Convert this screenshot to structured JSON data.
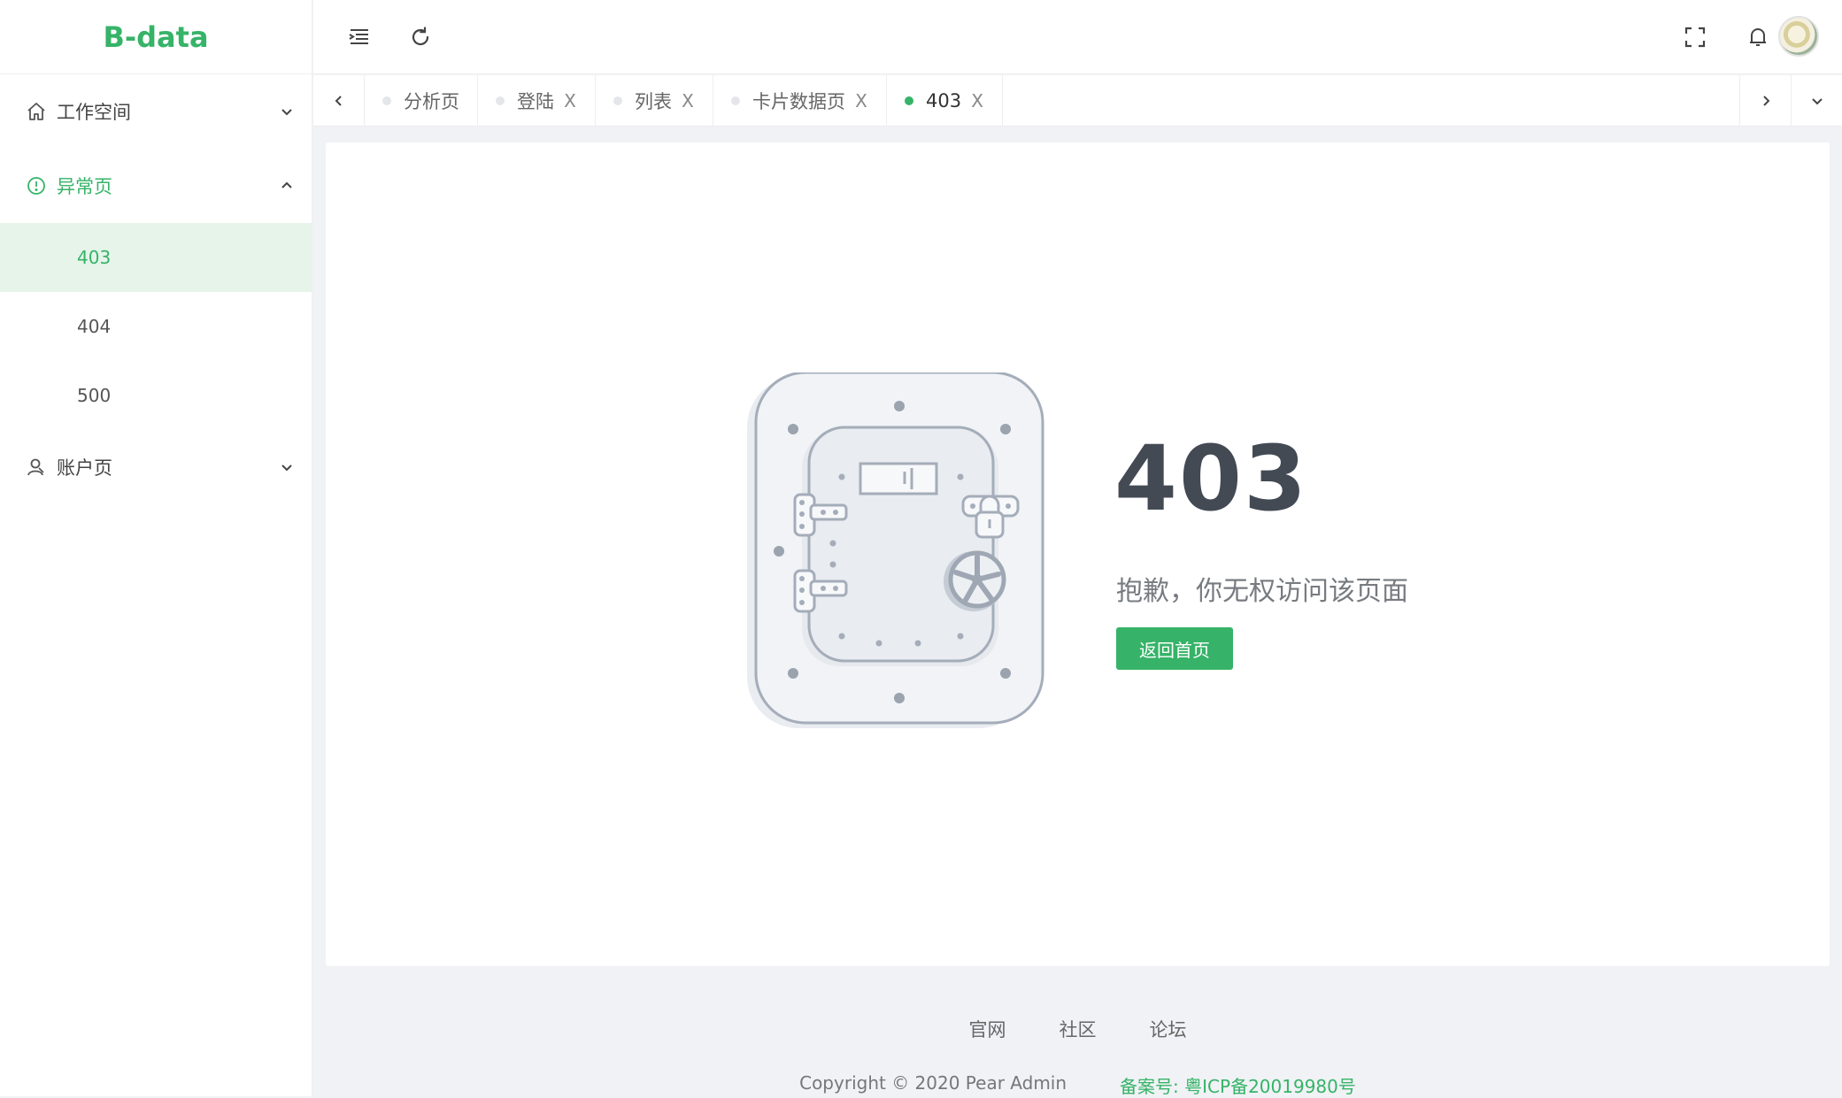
{
  "app": {
    "logo": "B-data",
    "brand_color": "#36b368"
  },
  "sidebar": {
    "groups": [
      {
        "label": "工作空间",
        "icon": "home-icon",
        "expanded": false
      },
      {
        "label": "异常页",
        "icon": "alert-circle-icon",
        "expanded": true,
        "items": [
          {
            "label": "403",
            "active": true
          },
          {
            "label": "404"
          },
          {
            "label": "500"
          }
        ]
      },
      {
        "label": "账户页",
        "icon": "user-icon",
        "expanded": false
      }
    ]
  },
  "header": {
    "icons": [
      "menu-fold-icon",
      "refresh-icon",
      "fullscreen-icon",
      "bell-icon",
      "avatar"
    ]
  },
  "tabs": [
    {
      "label": "分析页",
      "closable": false,
      "active": false
    },
    {
      "label": "登陆",
      "closable": true,
      "active": false
    },
    {
      "label": "列表",
      "closable": true,
      "active": false
    },
    {
      "label": "卡片数据页",
      "closable": true,
      "active": false
    },
    {
      "label": "403",
      "closable": true,
      "active": true
    }
  ],
  "tab_close_glyph": "X",
  "error": {
    "code": "403",
    "message": "抱歉，你无权访问该页面",
    "button": "返回首页"
  },
  "footer": {
    "links": [
      "官网",
      "社区",
      "论坛"
    ],
    "copyright": "Copyright © 2020 Pear Admin",
    "icp": "备案号: 粤ICP备20019980号"
  }
}
